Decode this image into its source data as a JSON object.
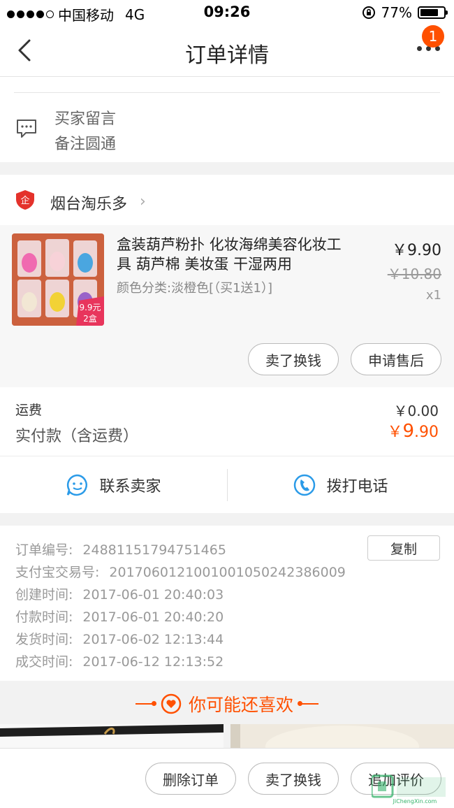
{
  "status_bar": {
    "carrier": "中国移动",
    "network": "4G",
    "time": "09:26",
    "battery": "77%",
    "battery_level": 0.77
  },
  "navbar": {
    "title": "订单详情",
    "badge_count": "1"
  },
  "message": {
    "label": "买家留言",
    "text": "备注圆通"
  },
  "shop": {
    "name": "烟台淘乐多"
  },
  "product": {
    "name": "盒装葫芦粉扑 化妆海绵美容化妆工具 葫芦棉 美妆蛋 干湿两用",
    "spec": "颜色分类:淡橙色[（买1送1）]",
    "price": "￥9.90",
    "original_price": "￥10.80",
    "quantity": "x1",
    "image_tag_price": "9.9元",
    "image_tag_count": "2盒",
    "actions": {
      "sell": "卖了换钱",
      "after_sale": "申请售后"
    }
  },
  "fees": {
    "shipping_label": "运费",
    "shipping_value": "￥0.00",
    "paid_label": "实付款（含运费）",
    "paid_currency": "￥",
    "paid_integer": "9",
    "paid_decimal": ".90"
  },
  "contact": {
    "seller": "联系卖家",
    "phone": "拨打电话"
  },
  "order_info": {
    "copy_button": "复制",
    "rows": [
      {
        "label": "订单编号:",
        "value": "24881151794751465"
      },
      {
        "label": "支付宝交易号:",
        "value": "2017060121001001050242386009"
      },
      {
        "label": "创建时间:",
        "value": "2017-06-01 20:40:03"
      },
      {
        "label": "付款时间:",
        "value": "2017-06-01 20:40:20"
      },
      {
        "label": "发货时间:",
        "value": "2017-06-02 12:13:44"
      },
      {
        "label": "成交时间:",
        "value": "2017-06-12 12:13:52"
      }
    ]
  },
  "recommend": {
    "title": "你可能还喜欢"
  },
  "bottom_bar": {
    "delete": "删除订单",
    "sell": "卖了换钱",
    "review": "追加评价"
  },
  "watermark": {
    "site": "JiChengXin.com"
  },
  "colors": {
    "accent": "#ff5000",
    "icon_blue": "#2b9be8"
  }
}
